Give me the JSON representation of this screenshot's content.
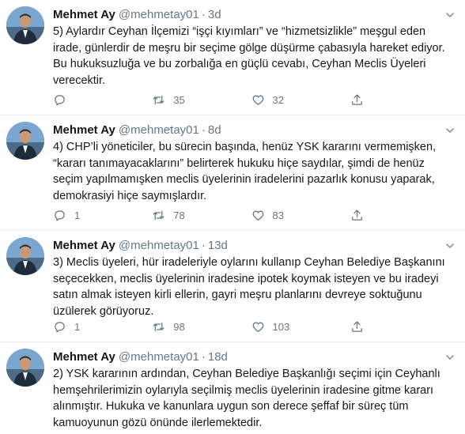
{
  "tweets": [
    {
      "name": "Mehmet Ay",
      "handle": "@mehmetay01",
      "separator": "·",
      "time": "3d",
      "text": "5) Aylardır Ceyhan İlçemizi “işçi kıyımları” ve “hizmetsizlikle” meşgul eden irade, günlerdir de meşru bir seçime gölge düşürme çabasıyla hareket ediyor. Bu hukuksuzluğa ve bu zorbalığa en güçlü cevabı, Ceyhan Meclis Üyeleri verecektir.",
      "replies": "",
      "retweets": "35",
      "likes": "32"
    },
    {
      "name": "Mehmet Ay",
      "handle": "@mehmetay01",
      "separator": "·",
      "time": "8d",
      "text": "4) CHP’li yöneticiler, bu sürecin başında, henüz YSK kararını vermemişken, “kararı tanımayacaklarını” belirterek hukuku hiçe saydılar, şimdi de henüz seçim yapılmamışken meclis üyelerinin iradelerini pazarlık konusu yaparak, demokrasiyi hiçe saymışlardır.",
      "replies": "1",
      "retweets": "78",
      "likes": "83"
    },
    {
      "name": "Mehmet Ay",
      "handle": "@mehmetay01",
      "separator": "·",
      "time": "13d",
      "text": "3) Meclis üyeleri, hür iradeleriyle oylarını kullanıp Ceyhan Belediye Başkanını seçecekken, meclis üyelerinin iradesine ipotek koymak isteyen ve bu iradeyi satın almak isteyen kirli ellerin, gayri meşru planlarını devreye soktuğunu üzülerek görüyoruz.",
      "replies": "1",
      "retweets": "98",
      "likes": "103"
    },
    {
      "name": "Mehmet Ay",
      "handle": "@mehmetay01",
      "separator": "·",
      "time": "18d",
      "text": "2) YSK kararının ardından, Ceyhan Belediye Başkanlığı seçimi için Ceyhanlı hemşehrilerimizin oylarıyla seçilmiş meclis üyelerinin iradesine gitme kararı alınmıştır. Hukuka ve kanunlara uygun son derece şeffaf bir süreç tüm kamuoyunun gözü önünde ilerlemektedir.",
      "replies": "",
      "retweets": "",
      "likes": ""
    }
  ],
  "icons": {
    "reply": "reply-icon",
    "retweet": "retweet-icon",
    "like": "heart-icon",
    "share": "share-icon",
    "caret": "chevron-down-icon",
    "avatar": "avatar"
  },
  "colors": {
    "text": "#14171a",
    "secondary": "#657786",
    "border": "#e6ecf0"
  }
}
